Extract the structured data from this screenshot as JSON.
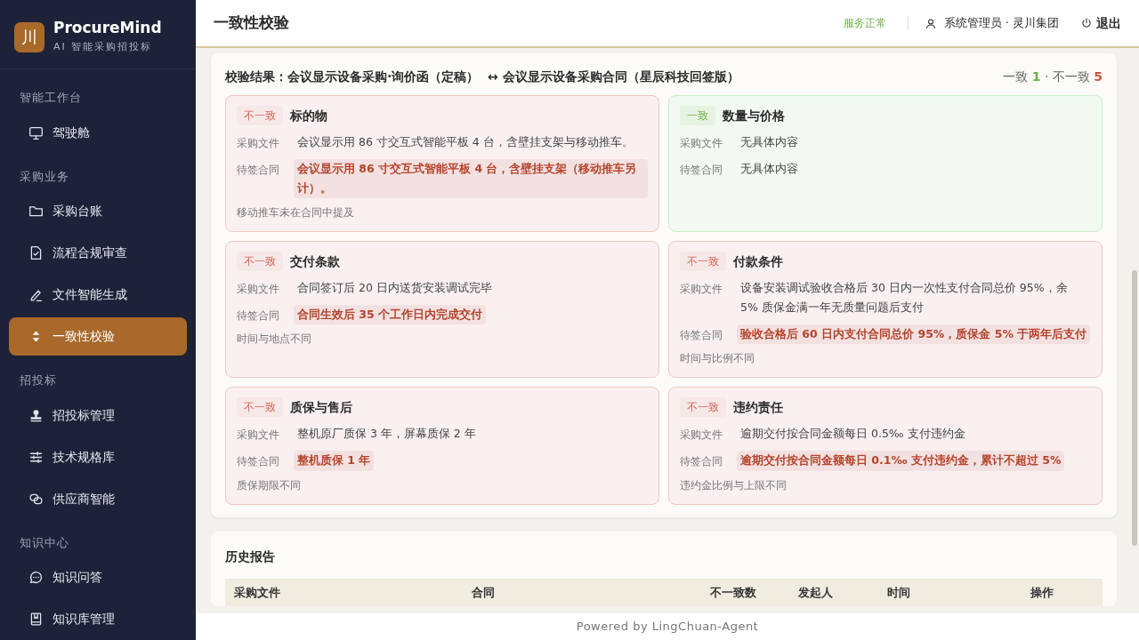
{
  "brand": {
    "logo": "川",
    "name": "ProcureMind",
    "tagline": "AI 智能采购招投标"
  },
  "sidebar": {
    "sections": [
      {
        "title": "智能工作台",
        "items": [
          {
            "label": "驾驶舱",
            "selected": false
          }
        ]
      },
      {
        "title": "采购业务",
        "items": [
          {
            "label": "采购台账",
            "selected": false
          },
          {
            "label": "流程合规审查",
            "selected": false
          },
          {
            "label": "文件智能生成",
            "selected": false
          },
          {
            "label": "一致性校验",
            "selected": true
          }
        ]
      },
      {
        "title": "招投标",
        "items": [
          {
            "label": "招投标管理",
            "selected": false
          },
          {
            "label": "技术规格库",
            "selected": false
          },
          {
            "label": "供应商智能",
            "selected": false
          }
        ]
      },
      {
        "title": "知识中心",
        "items": [
          {
            "label": "知识问答",
            "selected": false
          },
          {
            "label": "知识库管理",
            "selected": false
          }
        ]
      }
    ]
  },
  "header": {
    "title": "一致性校验",
    "status": "服务正常",
    "user": "系统管理员 · 灵川集团",
    "logout": "退出"
  },
  "result": {
    "label": "校验结果：",
    "doc_a": "会议显示设备采购·询价函（定稿）",
    "arrow": "↔",
    "doc_b": "会议显示设备采购合同（星辰科技回签版）",
    "match_label": "一致",
    "match_count": "1",
    "sep": "·",
    "mismatch_label": "不一致",
    "mismatch_count": "5",
    "items": [
      {
        "consistent": false,
        "tag": "不一致",
        "title": "标的物",
        "rows": [
          {
            "label": "采购文件",
            "text": "会议显示用 86 寸交互式智能平板 4 台，含壁挂支架与移动推车。",
            "highlight": false
          },
          {
            "label": "待签合同",
            "text": "会议显示用 86 寸交互式智能平板 4 台，含壁挂支架（移动推车另计）。",
            "highlight": true
          }
        ],
        "note": "移动推车未在合同中提及"
      },
      {
        "consistent": true,
        "tag": "一致",
        "title": "数量与价格",
        "rows": [
          {
            "label": "采购文件",
            "text": "无具体内容",
            "highlight": false
          },
          {
            "label": "待签合同",
            "text": "无具体内容",
            "highlight": false
          }
        ]
      },
      {
        "consistent": false,
        "tag": "不一致",
        "title": "交付条款",
        "rows": [
          {
            "label": "采购文件",
            "text": "合同签订后 20 日内送货安装调试完毕",
            "highlight": false
          },
          {
            "label": "待签合同",
            "text": "合同生效后 35 个工作日内完成交付",
            "highlight": true
          }
        ],
        "note": "时间与地点不同"
      },
      {
        "consistent": false,
        "tag": "不一致",
        "title": "付款条件",
        "rows": [
          {
            "label": "采购文件",
            "text": "设备安装调试验收合格后 30 日内一次性支付合同总价 95%，余 5% 质保金满一年无质量问题后支付",
            "highlight": false
          },
          {
            "label": "待签合同",
            "text": "验收合格后 60 日内支付合同总价 95%，质保金 5% 于两年后支付",
            "highlight": true
          }
        ],
        "note": "时间与比例不同"
      },
      {
        "consistent": false,
        "tag": "不一致",
        "title": "质保与售后",
        "rows": [
          {
            "label": "采购文件",
            "text": "整机原厂质保 3 年，屏幕质保 2 年",
            "highlight": false
          },
          {
            "label": "待签合同",
            "text": "整机质保 1 年",
            "highlight": true
          }
        ],
        "note": "质保期限不同"
      },
      {
        "consistent": false,
        "tag": "不一致",
        "title": "违约责任",
        "rows": [
          {
            "label": "采购文件",
            "text": "逾期交付按合同金额每日 0.5‰ 支付违约金",
            "highlight": false
          },
          {
            "label": "待签合同",
            "text": "逾期交付按合同金额每日 0.1‰ 支付违约金，累计不超过 5%",
            "highlight": true
          }
        ],
        "note": "违约金比例与上限不同"
      }
    ]
  },
  "history": {
    "title": "历史报告",
    "table": {
      "columns": [
        "采购文件",
        "合同",
        "不一致数",
        "发起人",
        "时间",
        "操作"
      ]
    }
  },
  "footer": "Powered by LingChuan-Agent"
}
